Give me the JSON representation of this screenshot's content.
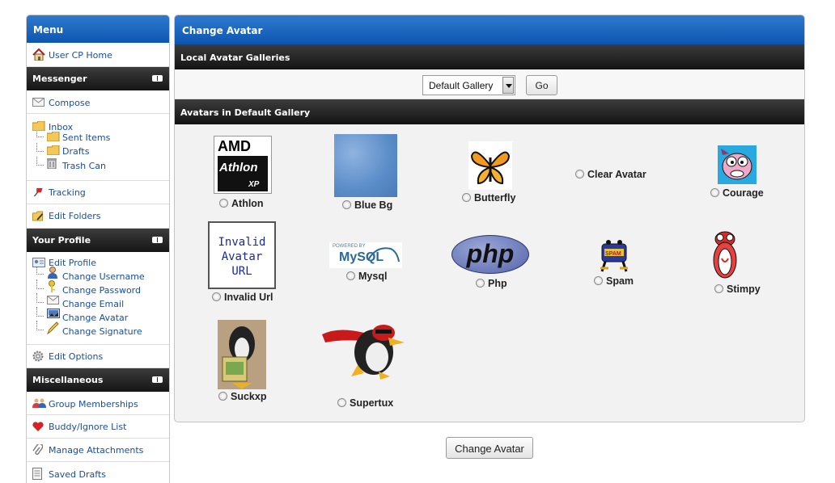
{
  "sidebar": {
    "menu_title": "Menu",
    "user_cp_home": "User CP Home",
    "messenger": {
      "title": "Messenger",
      "compose": "Compose",
      "inbox": "Inbox",
      "sent_items": "Sent Items",
      "drafts": "Drafts",
      "trash_can": "Trash Can",
      "tracking": "Tracking",
      "edit_folders": "Edit Folders"
    },
    "profile": {
      "title": "Your Profile",
      "edit_profile": "Edit Profile",
      "change_username": "Change Username",
      "change_password": "Change Password",
      "change_email": "Change Email",
      "change_avatar": "Change Avatar",
      "change_signature": "Change Signature",
      "edit_options": "Edit Options"
    },
    "misc": {
      "title": "Miscellaneous",
      "group_memberships": "Group Memberships",
      "buddy_ignore": "Buddy/Ignore List",
      "manage_attachments": "Manage Attachments",
      "saved_drafts": "Saved Drafts"
    }
  },
  "main": {
    "title": "Change Avatar",
    "local_galleries_title": "Local Avatar Galleries",
    "gallery_select": {
      "selected": "Default Gallery"
    },
    "go_label": "Go",
    "avatars_title": "Avatars in Default Gallery",
    "avatars": {
      "athlon": "Athlon",
      "blue_bg": "Blue Bg",
      "butterfly": "Butterfly",
      "clear_avatar": "Clear Avatar",
      "courage": "Courage",
      "invalid_url": "Invalid Url",
      "mysql": "Mysql",
      "php": "Php",
      "spam": "Spam",
      "stimpy": "Stimpy",
      "suckxp": "Suckxp",
      "supertux": "Supertux"
    },
    "invalid_image_text": [
      "Invalid",
      "Avatar",
      "URL"
    ],
    "amd_text": "AMD",
    "athlon_logo_text": "Athlon",
    "xp_text": "XP",
    "mysql_powered": "POWERED BY",
    "mysql_logo": "MySQL",
    "php_logo": "php",
    "spam_logo": "SPAM",
    "submit_label": "Change Avatar"
  },
  "colors": {
    "header_blue": "#0d56b0",
    "bar_black": "#151515",
    "link_blue": "#1a4ea0",
    "panel_bg": "#f2f2f2"
  }
}
